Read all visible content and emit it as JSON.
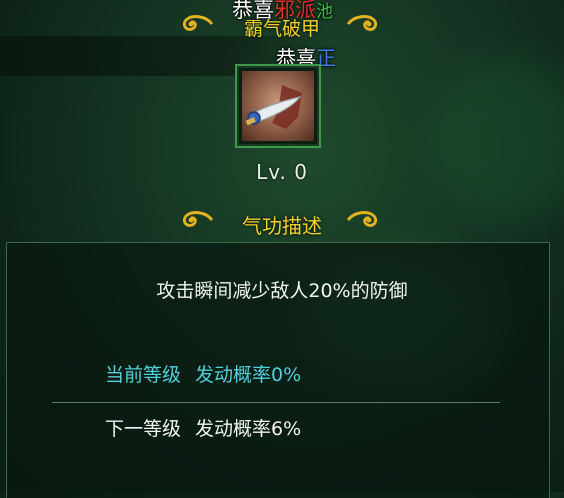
{
  "header": {
    "player_name": "恭喜",
    "evil_faction": "邪派",
    "extra_char": "池",
    "skill_name": "霸气破甲",
    "player_name_2": "恭喜",
    "good_faction": "正"
  },
  "skill": {
    "icon": "curved-sword-icon",
    "level": "Lv. 0"
  },
  "section": {
    "title": "气功描述"
  },
  "description": {
    "text": "攻击瞬间减少敌人20%的防御",
    "current_label": "当前等级",
    "current_value": "发动概率0%",
    "next_label": "下一等级",
    "next_value": "发动概率6%"
  },
  "colors": {
    "gold": "#f2cf2b",
    "cyan": "#52cfdc",
    "frame_green": "#3e9a48",
    "evil_red": "#e0302a",
    "good_blue": "#3d79e6"
  }
}
